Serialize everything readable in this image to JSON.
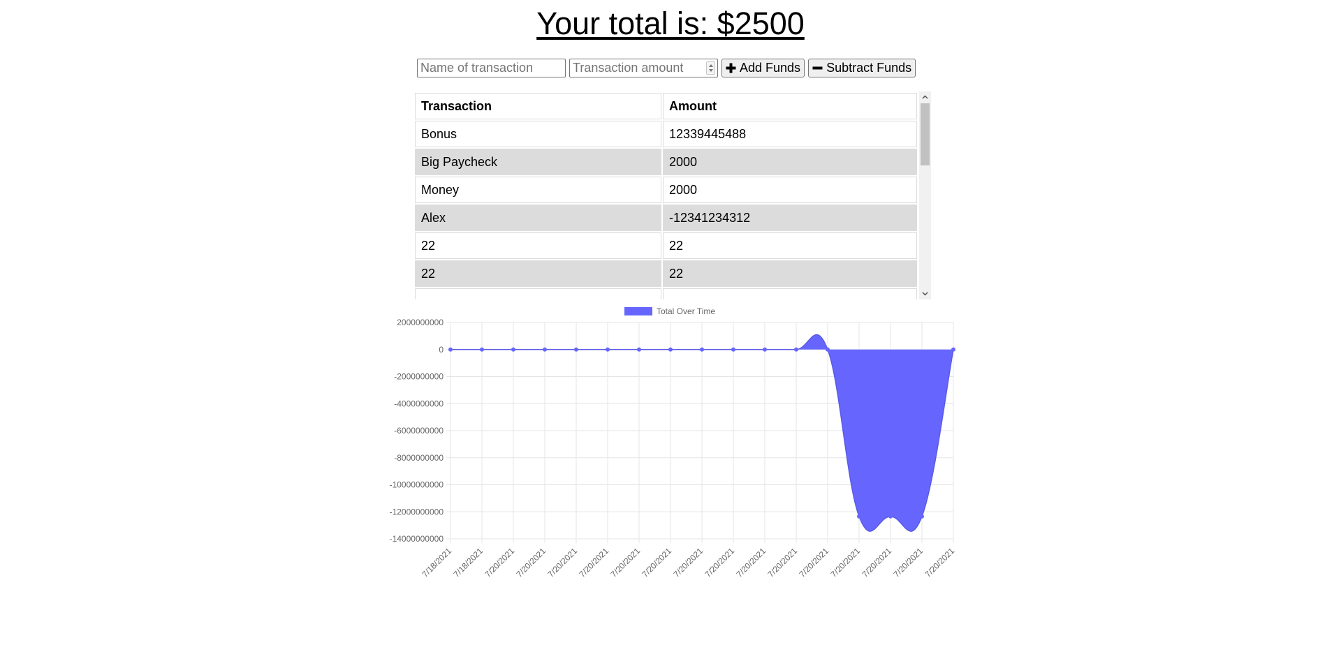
{
  "header": {
    "total_text": "Your total is: $2500"
  },
  "form": {
    "name_placeholder": "Name of transaction",
    "amount_placeholder": "Transaction amount",
    "add_label": "Add Funds",
    "subtract_label": "Subtract Funds"
  },
  "table": {
    "headers": [
      "Transaction",
      "Amount"
    ],
    "rows": [
      [
        "Bonus",
        "12339445488"
      ],
      [
        "Big Paycheck",
        "2000"
      ],
      [
        "Money",
        "2000"
      ],
      [
        "Alex",
        "-12341234312"
      ],
      [
        "22",
        "22"
      ],
      [
        "22",
        "22"
      ]
    ]
  },
  "icons": {
    "add": "plus-icon",
    "subtract": "minus-icon",
    "scroll_up": "chevron-up-icon",
    "scroll_down": "chevron-down-icon"
  },
  "colors": {
    "series_fill": "#6666ff",
    "series_point": "#6666ff",
    "grid": "#e5e5e5",
    "stripe": "#dcdcdc"
  },
  "chart_data": {
    "type": "area",
    "title": "",
    "legend": {
      "position": "top",
      "entries": [
        "Total Over Time"
      ]
    },
    "xlabel": "",
    "ylabel": "",
    "x": [
      "7/18/2021",
      "7/18/2021",
      "7/20/2021",
      "7/20/2021",
      "7/20/2021",
      "7/20/2021",
      "7/20/2021",
      "7/20/2021",
      "7/20/2021",
      "7/20/2021",
      "7/20/2021",
      "7/20/2021",
      "7/20/2021",
      "7/20/2021",
      "7/20/2021",
      "7/20/2021",
      "7/20/2021"
    ],
    "series": [
      {
        "name": "Total Over Time",
        "values": [
          0,
          0,
          0,
          0,
          0,
          0,
          0,
          0,
          0,
          0,
          0,
          0,
          0,
          -12341230000,
          -12341230000,
          -12341230000,
          2500
        ]
      }
    ],
    "ylim": [
      -14000000000,
      2000000000
    ],
    "yticks": [
      2000000000,
      0,
      -2000000000,
      -4000000000,
      -6000000000,
      -8000000000,
      -10000000000,
      -12000000000,
      -14000000000
    ],
    "grid": true
  }
}
